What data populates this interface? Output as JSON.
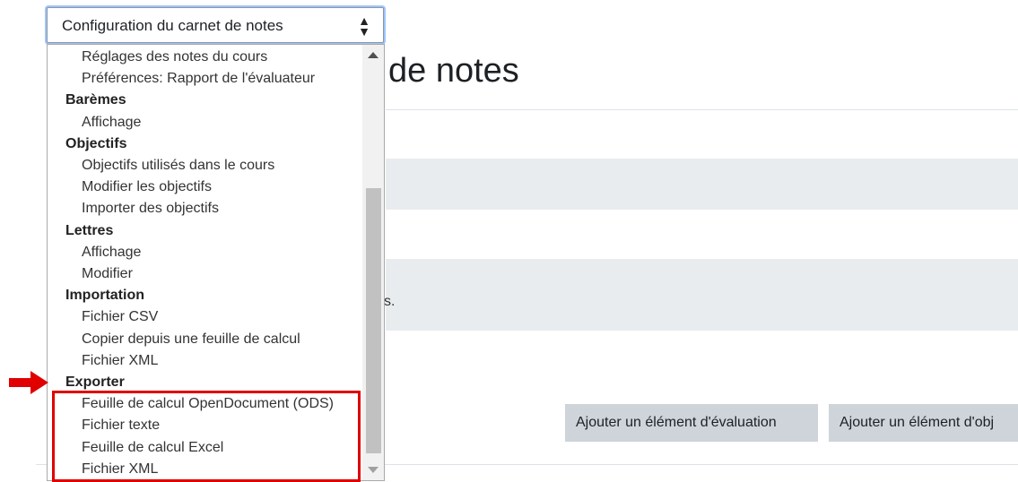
{
  "select": {
    "value": "Configuration du carnet de notes"
  },
  "page": {
    "title_fragment": "de notes",
    "dot_text": "s.",
    "buttons": {
      "add_evaluation": "Ajouter un élément d'évaluation",
      "add_objective": "Ajouter un élément d'obj"
    }
  },
  "dropdown": {
    "items": [
      {
        "type": "child",
        "label": "Réglages des notes du cours"
      },
      {
        "type": "child",
        "label": "Préférences: Rapport de l'évaluateur"
      },
      {
        "type": "group",
        "label": "Barèmes"
      },
      {
        "type": "child",
        "label": "Affichage"
      },
      {
        "type": "group",
        "label": "Objectifs"
      },
      {
        "type": "child",
        "label": "Objectifs utilisés dans le cours"
      },
      {
        "type": "child",
        "label": "Modifier les objectifs"
      },
      {
        "type": "child",
        "label": "Importer des objectifs"
      },
      {
        "type": "group",
        "label": "Lettres"
      },
      {
        "type": "child",
        "label": "Affichage"
      },
      {
        "type": "child",
        "label": "Modifier"
      },
      {
        "type": "group",
        "label": "Importation"
      },
      {
        "type": "child",
        "label": "Fichier CSV"
      },
      {
        "type": "child",
        "label": "Copier depuis une feuille de calcul"
      },
      {
        "type": "child",
        "label": "Fichier XML"
      },
      {
        "type": "group",
        "label": "Exporter"
      },
      {
        "type": "child",
        "label": "Feuille de calcul OpenDocument (ODS)"
      },
      {
        "type": "child",
        "label": "Fichier texte"
      },
      {
        "type": "child",
        "label": "Feuille de calcul Excel"
      },
      {
        "type": "child",
        "label": "Fichier XML"
      }
    ]
  },
  "colors": {
    "highlight_border": "#e00000",
    "arrow": "#e00000",
    "button_bg": "#ced4da"
  }
}
